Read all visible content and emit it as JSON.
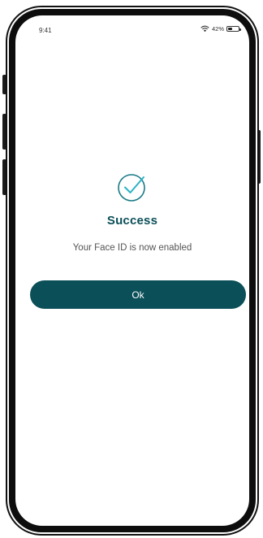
{
  "status_bar": {
    "time": "9:41",
    "battery_percent_label": "42%",
    "battery_level": 0.42,
    "wifi_icon": "wifi-icon",
    "battery_icon": "battery-icon"
  },
  "result": {
    "icon": "check-circle-icon",
    "title": "Success",
    "message": "Your Face ID is now enabled"
  },
  "actions": {
    "ok_label": "Ok"
  },
  "colors": {
    "primary": "#0b4f58",
    "icon_stroke": "#1a7a86",
    "check_accent": "#2bb3c4",
    "message_text": "#555555"
  }
}
